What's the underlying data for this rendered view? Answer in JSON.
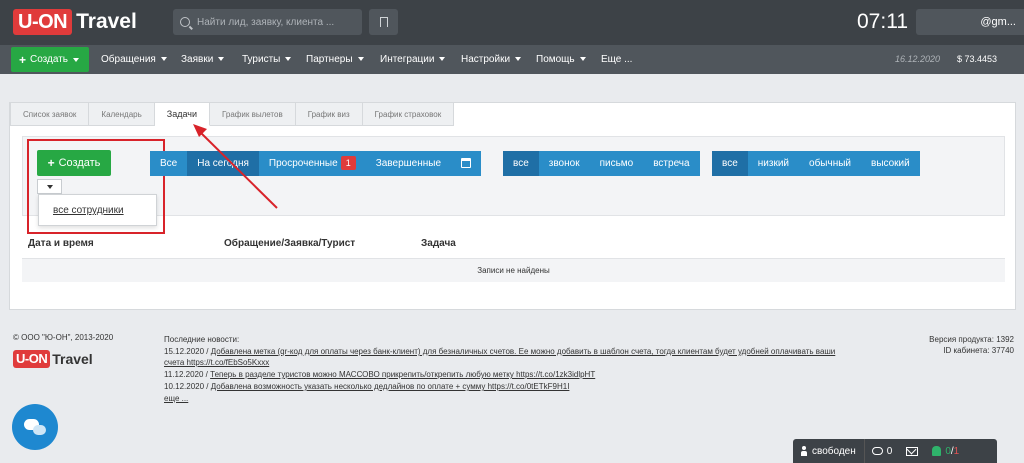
{
  "header": {
    "logo_box": "U-ON",
    "logo_text": "Travel",
    "search_placeholder": "Найти лид, заявку, клиента ...",
    "clock": "07:11",
    "user": "@gm..."
  },
  "nav": {
    "create_label": "Создать",
    "items": [
      "Обращения",
      "Заявки",
      "Туристы",
      "Партнеры",
      "Интеграции",
      "Настройки",
      "Помощь",
      "Еще ..."
    ],
    "date": "16.12.2020",
    "balance": "$ 73.4453"
  },
  "tabs": [
    "Список заявок",
    "Календарь",
    "Задачи",
    "График вылетов",
    "График виз",
    "График страховок"
  ],
  "toolbar": {
    "create_label": "Создать",
    "dropdown_item": "все сотрудники",
    "period_buttons": [
      "Все",
      "На сегодня",
      "Просроченные",
      "Завершенные"
    ],
    "overdue_badge": "1",
    "type_buttons": [
      "все",
      "звонок",
      "письмо",
      "встреча"
    ],
    "priority_buttons": [
      "все",
      "низкий",
      "обычный",
      "высокий"
    ]
  },
  "table": {
    "columns": [
      "Дата и время",
      "Обращение/Заявка/Турист",
      "Задача"
    ],
    "empty": "Записи не найдены"
  },
  "footer": {
    "copyright": "© ООО \"Ю-ОН\", 2013-2020",
    "news_title": "Последние новости:",
    "news": [
      {
        "date": "15.12.2020 /",
        "text": "Добавлена метка (qr-код для оплаты через банк-клиент) для безналичных счетов. Ее можно добавить в шаблон счета, тогда клиентам будет удобней оплачивать ваши"
      },
      {
        "date": "",
        "text": "счета https://t.co/fEbSo5Kxxx"
      },
      {
        "date": "11.12.2020 /",
        "text": "Теперь в разделе туристов можно МАССОВО прикрепить/открепить любую метку https://t.co/1zk3idlpHT"
      },
      {
        "date": "10.12.2020 /",
        "text": "Добавлена возможность указать несколько дедлайнов по оплате + сумму https://t.co/0tETkF9H1I"
      }
    ],
    "news_more": "еще ...",
    "version": "Версия продукта: 1392",
    "cabinet": "ID кабинета: 37740"
  },
  "statusbar": {
    "status": "свободен",
    "comments": "0",
    "notif_green": "0",
    "notif_sep": "/",
    "notif_red": "1"
  }
}
